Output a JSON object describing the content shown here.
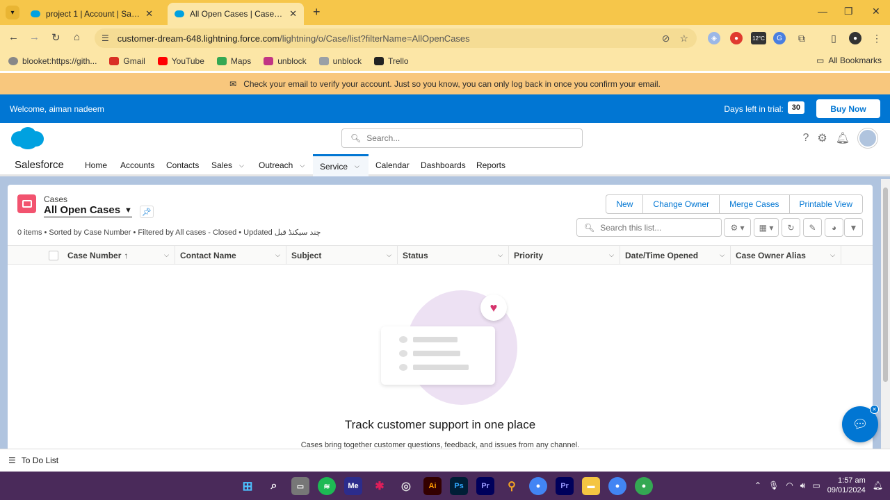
{
  "browser": {
    "tabs": [
      {
        "title": "project 1 | Account | Salesforce",
        "active": false
      },
      {
        "title": "All Open Cases | Cases | Salesforce",
        "active": true
      }
    ],
    "url_host": "customer-dream-648.lightning.force.com",
    "url_path": "/lightning/o/Case/list?filterName=AllOpenCases",
    "weather_badge": "12°C",
    "bookmarks": [
      {
        "label": "blooket:https://gith...",
        "icon": "globe-icon",
        "color": "#888888"
      },
      {
        "label": "Gmail",
        "icon": "gmail-icon",
        "color": "#d93025"
      },
      {
        "label": "YouTube",
        "icon": "youtube-icon",
        "color": "#ff0000"
      },
      {
        "label": "Maps",
        "icon": "maps-icon",
        "color": "#34a853"
      },
      {
        "label": "unblock",
        "icon": "instagram-icon",
        "color": "#c13584"
      },
      {
        "label": "unblock",
        "icon": "cloud-icon",
        "color": "#9aa0a6"
      },
      {
        "label": "Trello",
        "icon": "trello-icon",
        "color": "#222222"
      }
    ],
    "all_bookmarks": "All Bookmarks"
  },
  "banner": {
    "verify_text": "Check your email to verify your account. Just so you know, you can only log back in once you confirm your email."
  },
  "trial": {
    "welcome": "Welcome, aiman nadeem",
    "days_label": "Days left in trial:",
    "days_count": "30",
    "buy_label": "Buy Now"
  },
  "header": {
    "search_placeholder": "Search..."
  },
  "nav": {
    "app_name": "Salesforce",
    "items": [
      {
        "label": "Home",
        "dropdown": false
      },
      {
        "label": "Accounts",
        "dropdown": false
      },
      {
        "label": "Contacts",
        "dropdown": false
      },
      {
        "label": "Sales",
        "dropdown": true
      },
      {
        "label": "Outreach",
        "dropdown": true
      },
      {
        "label": "Service",
        "dropdown": true,
        "active": true
      },
      {
        "label": "Calendar",
        "dropdown": false
      },
      {
        "label": "Dashboards",
        "dropdown": false
      },
      {
        "label": "Reports",
        "dropdown": false
      }
    ]
  },
  "list": {
    "object_label": "Cases",
    "view_name": "All Open Cases",
    "meta": "0 items • Sorted by Case Number • Filtered by All cases - Closed • Updated چند سیکنڈ قبل",
    "actions": [
      "New",
      "Change Owner",
      "Merge Cases",
      "Printable View"
    ],
    "search_placeholder": "Search this list...",
    "columns": [
      "Case Number",
      "Contact Name",
      "Subject",
      "Status",
      "Priority",
      "Date/Time Opened",
      "Case Owner Alias"
    ],
    "sort_indicator": "↑",
    "empty_title": "Track customer support in one place",
    "empty_subtitle": "Cases bring together customer questions, feedback, and issues from any channel."
  },
  "utility": {
    "todo_label": "To Do List"
  },
  "taskbar": {
    "time": "1:57 am",
    "date": "09/01/2024"
  },
  "colors": {
    "brand_blue": "#0176d3",
    "case_icon": "#f2536f",
    "browser_tab": "#f6c64a",
    "banner": "#f8c77d"
  }
}
